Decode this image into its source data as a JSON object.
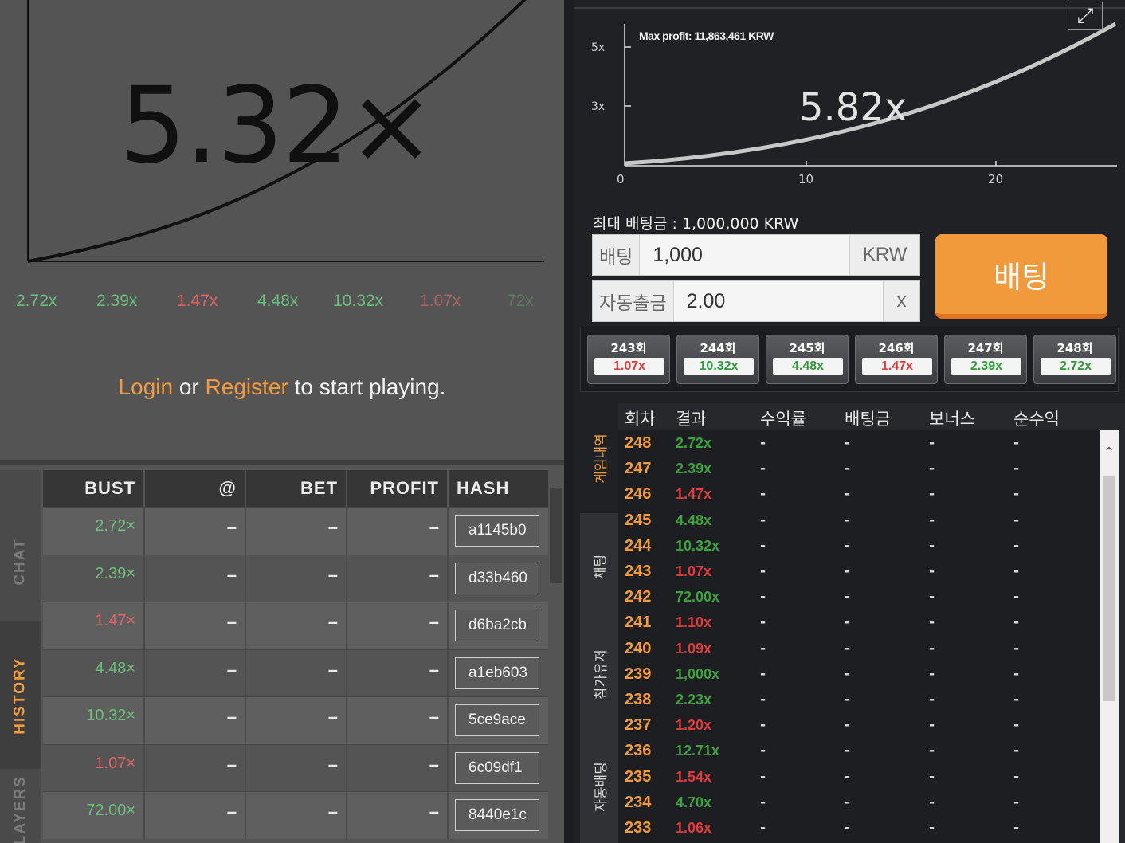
{
  "left": {
    "multiplier": "5.32×",
    "recent": [
      {
        "text": "2.72x",
        "color": "#6ac07a"
      },
      {
        "text": "2.39x",
        "color": "#6ac07a"
      },
      {
        "text": "1.47x",
        "color": "#e46262"
      },
      {
        "text": "4.48x",
        "color": "#6ac07a"
      },
      {
        "text": "10.32x",
        "color": "#6ac07a"
      },
      {
        "text": "1.07x",
        "color": "#a86363"
      },
      {
        "text": "72x",
        "color": "#5e7a62"
      }
    ],
    "login": {
      "login": "Login",
      "or": " or ",
      "register": "Register",
      "rest": " to start playing."
    },
    "tabs": {
      "chat": "CHAT",
      "history": "HISTORY",
      "players": "PLAYERS"
    },
    "table": {
      "headers": {
        "bust": "BUST",
        "at": "@",
        "bet": "BET",
        "profit": "PROFIT",
        "hash": "HASH"
      },
      "rows": [
        {
          "bust": "2.72×",
          "color": "#6ac07a",
          "at": "–",
          "bet": "–",
          "profit": "–",
          "hash": "a1145b0"
        },
        {
          "bust": "2.39×",
          "color": "#6ac07a",
          "at": "–",
          "bet": "–",
          "profit": "–",
          "hash": "d33b460"
        },
        {
          "bust": "1.47×",
          "color": "#e46262",
          "at": "–",
          "bet": "–",
          "profit": "–",
          "hash": "d6ba2cb"
        },
        {
          "bust": "4.48×",
          "color": "#6ac07a",
          "at": "–",
          "bet": "–",
          "profit": "–",
          "hash": "a1eb603"
        },
        {
          "bust": "10.32×",
          "color": "#6ac07a",
          "at": "–",
          "bet": "–",
          "profit": "–",
          "hash": "5ce9ace"
        },
        {
          "bust": "1.07×",
          "color": "#e46262",
          "at": "–",
          "bet": "–",
          "profit": "–",
          "hash": "6c09df1"
        },
        {
          "bust": "72.00×",
          "color": "#6ac07a",
          "at": "–",
          "bet": "–",
          "profit": "–",
          "hash": "8440e1c"
        }
      ]
    }
  },
  "right": {
    "graph": {
      "max_profit": "Max profit: 11,863,461 KRW",
      "multiplier": "5.82x",
      "y_ticks": [
        "5x",
        "3x"
      ],
      "x_ticks": [
        "0",
        "10",
        "20"
      ]
    },
    "expand_icon": "expand-icon",
    "max_bet": "최대 배팅금 : 1,000,000 KRW",
    "bet": {
      "label": "배팅",
      "value": "1,000",
      "unit": "KRW"
    },
    "auto": {
      "label": "자동출금",
      "value": "2.00",
      "unit": "x"
    },
    "bet_button": "배팅",
    "rounds": [
      {
        "no": "243회",
        "val": "1.07x",
        "color": "#e23a3a"
      },
      {
        "no": "244회",
        "val": "10.32x",
        "color": "#2e9a3a"
      },
      {
        "no": "245회",
        "val": "4.48x",
        "color": "#2e9a3a"
      },
      {
        "no": "246회",
        "val": "1.47x",
        "color": "#e23a3a"
      },
      {
        "no": "247회",
        "val": "2.39x",
        "color": "#2e9a3a"
      },
      {
        "no": "248회",
        "val": "2.72x",
        "color": "#2e9a3a"
      }
    ],
    "tabs": {
      "history": "게임내역",
      "chat": "채팅",
      "users": "참가유저",
      "auto": "자동배팅"
    },
    "list_headers": {
      "round": "회차",
      "result": "결과",
      "yield": "수익률",
      "bet": "배팅금",
      "bonus": "보너스",
      "net": "순수익"
    },
    "list_rows": [
      {
        "round": "248",
        "mult": "2.72x",
        "color": "#3aa43a",
        "d": "-"
      },
      {
        "round": "247",
        "mult": "2.39x",
        "color": "#3aa43a",
        "d": "-"
      },
      {
        "round": "246",
        "mult": "1.47x",
        "color": "#e23a3a",
        "d": "-"
      },
      {
        "round": "245",
        "mult": "4.48x",
        "color": "#3aa43a",
        "d": "-"
      },
      {
        "round": "244",
        "mult": "10.32x",
        "color": "#3aa43a",
        "d": "-"
      },
      {
        "round": "243",
        "mult": "1.07x",
        "color": "#e23a3a",
        "d": "-"
      },
      {
        "round": "242",
        "mult": "72.00x",
        "color": "#3aa43a",
        "d": "-"
      },
      {
        "round": "241",
        "mult": "1.10x",
        "color": "#e23a3a",
        "d": "-"
      },
      {
        "round": "240",
        "mult": "1.09x",
        "color": "#e23a3a",
        "d": "-"
      },
      {
        "round": "239",
        "mult": "1,000x",
        "color": "#3aa43a",
        "d": "-"
      },
      {
        "round": "238",
        "mult": "2.23x",
        "color": "#3aa43a",
        "d": "-"
      },
      {
        "round": "237",
        "mult": "1.20x",
        "color": "#e23a3a",
        "d": "-"
      },
      {
        "round": "236",
        "mult": "12.71x",
        "color": "#3aa43a",
        "d": "-"
      },
      {
        "round": "235",
        "mult": "1.54x",
        "color": "#e23a3a",
        "d": "-"
      },
      {
        "round": "234",
        "mult": "4.70x",
        "color": "#3aa43a",
        "d": "-"
      },
      {
        "round": "233",
        "mult": "1.06x",
        "color": "#e23a3a",
        "d": "-"
      }
    ],
    "scroll_up_icon": "chevron-up-icon"
  }
}
